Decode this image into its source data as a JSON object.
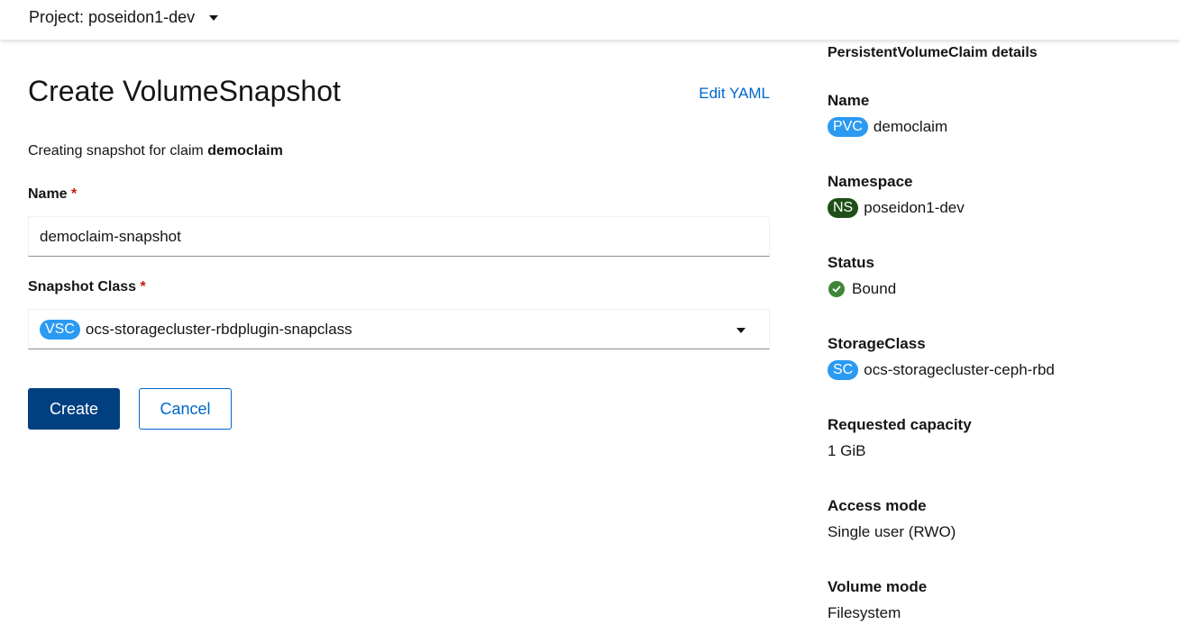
{
  "topbar": {
    "project_label": "Project: poseidon1-dev",
    "caret_icon": "caret-down-icon"
  },
  "form": {
    "title": "Create VolumeSnapshot",
    "edit_yaml": "Edit YAML",
    "subtitle_prefix": "Creating snapshot for claim",
    "subtitle_claim": "democlaim",
    "name_label": "Name",
    "required_mark": "*",
    "name_value": "democlaim-snapshot",
    "snapshot_class_label": "Snapshot Class",
    "snapshot_class_badge": "VSC",
    "snapshot_class_value": "ocs-storagecluster-rbdplugin-snapclass",
    "create_button": "Create",
    "cancel_button": "Cancel"
  },
  "details": {
    "title": "PersistentVolumeClaim details",
    "items": [
      {
        "term": "Name",
        "badge": "PVC",
        "value": "democlaim"
      },
      {
        "term": "Namespace",
        "badge": "NS",
        "value": "poseidon1-dev"
      },
      {
        "term": "Status",
        "icon": "check-circle-icon",
        "value": "Bound"
      },
      {
        "term": "StorageClass",
        "badge": "SC",
        "value": "ocs-storagecluster-ceph-rbd"
      },
      {
        "term": "Requested capacity",
        "value": "1 GiB"
      },
      {
        "term": "Access mode",
        "value": "Single user (RWO)"
      },
      {
        "term": "Volume mode",
        "value": "Filesystem"
      }
    ]
  },
  "colors": {
    "badge_blue": "#2b9af3",
    "badge_ns_green": "#1e4f18",
    "status_green": "#3e8635",
    "primary_button": "#004080",
    "link_blue": "#0066cc",
    "required_red": "#c9190b"
  }
}
